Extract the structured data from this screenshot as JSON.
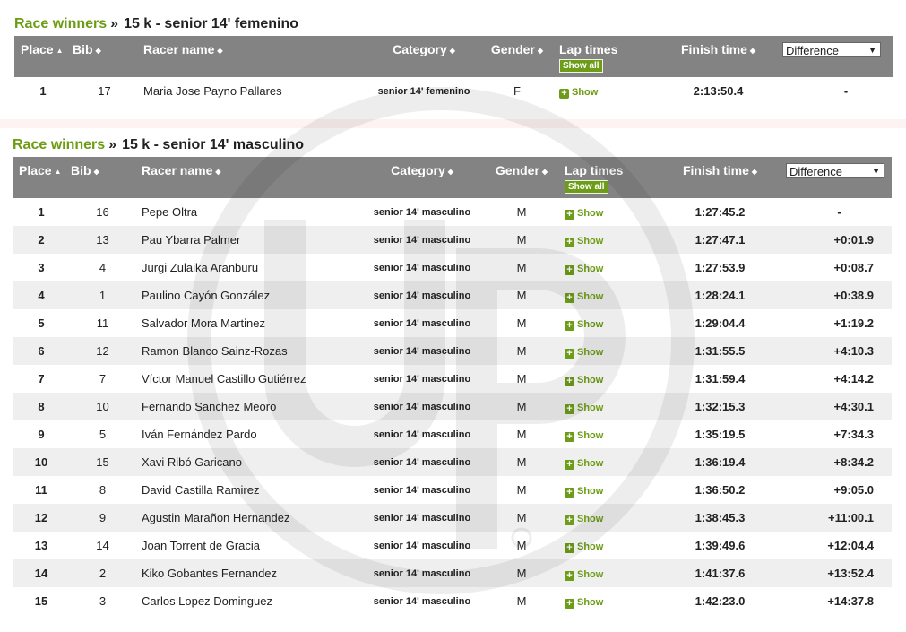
{
  "sections": [
    {
      "heading": {
        "link": "Race winners",
        "sep": "»",
        "title": "15 k - senior 14' femenino"
      },
      "columns": {
        "place": "Place",
        "bib": "Bib",
        "name": "Racer name",
        "category": "Category",
        "gender": "Gender",
        "lap": "Lap times",
        "show_all": "Show all",
        "finish": "Finish time"
      },
      "difference_select": {
        "selected": "Difference"
      },
      "rows": [
        {
          "place": "1",
          "bib": "17",
          "name": "Maria Jose Payno Pallares",
          "category": "senior 14' femenino",
          "gender": "F",
          "lap": "Show",
          "finish": "2:13:50.4",
          "diff": "-"
        }
      ]
    },
    {
      "heading": {
        "link": "Race winners",
        "sep": "»",
        "title": "15 k - senior 14' masculino"
      },
      "columns": {
        "place": "Place",
        "bib": "Bib",
        "name": "Racer name",
        "category": "Category",
        "gender": "Gender",
        "lap": "Lap times",
        "show_all": "Show all",
        "finish": "Finish time"
      },
      "difference_select": {
        "selected": "Difference"
      },
      "rows": [
        {
          "place": "1",
          "bib": "16",
          "name": "Pepe Oltra",
          "category": "senior 14' masculino",
          "gender": "M",
          "lap": "Show",
          "finish": "1:27:45.2",
          "diff": "-"
        },
        {
          "place": "2",
          "bib": "13",
          "name": "Pau Ybarra Palmer",
          "category": "senior 14' masculino",
          "gender": "M",
          "lap": "Show",
          "finish": "1:27:47.1",
          "diff": "+0:01.9"
        },
        {
          "place": "3",
          "bib": "4",
          "name": "Jurgi Zulaika Aranburu",
          "category": "senior 14' masculino",
          "gender": "M",
          "lap": "Show",
          "finish": "1:27:53.9",
          "diff": "+0:08.7"
        },
        {
          "place": "4",
          "bib": "1",
          "name": "Paulino Cayón González",
          "category": "senior 14' masculino",
          "gender": "M",
          "lap": "Show",
          "finish": "1:28:24.1",
          "diff": "+0:38.9"
        },
        {
          "place": "5",
          "bib": "11",
          "name": "Salvador Mora Martinez",
          "category": "senior 14' masculino",
          "gender": "M",
          "lap": "Show",
          "finish": "1:29:04.4",
          "diff": "+1:19.2"
        },
        {
          "place": "6",
          "bib": "12",
          "name": "Ramon Blanco Sainz-Rozas",
          "category": "senior 14' masculino",
          "gender": "M",
          "lap": "Show",
          "finish": "1:31:55.5",
          "diff": "+4:10.3"
        },
        {
          "place": "7",
          "bib": "7",
          "name": "Víctor Manuel Castillo Gutiérrez",
          "category": "senior 14' masculino",
          "gender": "M",
          "lap": "Show",
          "finish": "1:31:59.4",
          "diff": "+4:14.2"
        },
        {
          "place": "8",
          "bib": "10",
          "name": "Fernando Sanchez Meoro",
          "category": "senior 14' masculino",
          "gender": "M",
          "lap": "Show",
          "finish": "1:32:15.3",
          "diff": "+4:30.1"
        },
        {
          "place": "9",
          "bib": "5",
          "name": "Iván Fernández Pardo",
          "category": "senior 14' masculino",
          "gender": "M",
          "lap": "Show",
          "finish": "1:35:19.5",
          "diff": "+7:34.3"
        },
        {
          "place": "10",
          "bib": "15",
          "name": "Xavi Ribó Garicano",
          "category": "senior 14' masculino",
          "gender": "M",
          "lap": "Show",
          "finish": "1:36:19.4",
          "diff": "+8:34.2"
        },
        {
          "place": "11",
          "bib": "8",
          "name": "David Castilla Ramirez",
          "category": "senior 14' masculino",
          "gender": "M",
          "lap": "Show",
          "finish": "1:36:50.2",
          "diff": "+9:05.0"
        },
        {
          "place": "12",
          "bib": "9",
          "name": "Agustin Marañon Hernandez",
          "category": "senior 14' masculino",
          "gender": "M",
          "lap": "Show",
          "finish": "1:38:45.3",
          "diff": "+11:00.1"
        },
        {
          "place": "13",
          "bib": "14",
          "name": "Joan Torrent de Gracia",
          "category": "senior 14' masculino",
          "gender": "M",
          "lap": "Show",
          "finish": "1:39:49.6",
          "diff": "+12:04.4"
        },
        {
          "place": "14",
          "bib": "2",
          "name": "Kiko Gobantes Fernandez",
          "category": "senior 14' masculino",
          "gender": "M",
          "lap": "Show",
          "finish": "1:41:37.6",
          "diff": "+13:52.4"
        },
        {
          "place": "15",
          "bib": "3",
          "name": "Carlos Lopez Dominguez",
          "category": "senior 14' masculino",
          "gender": "M",
          "lap": "Show",
          "finish": "1:42:23.0",
          "diff": "+14:37.8"
        }
      ]
    }
  ],
  "icons": {
    "sort_asc": "sort-asc-icon",
    "sort_both": "sort-icon",
    "plus": "plus-icon",
    "dropdown": "caret-down-icon"
  },
  "colors": {
    "accent_green": "#6b9c12",
    "header_gray": "#838383",
    "row_alt": "#efefef"
  }
}
